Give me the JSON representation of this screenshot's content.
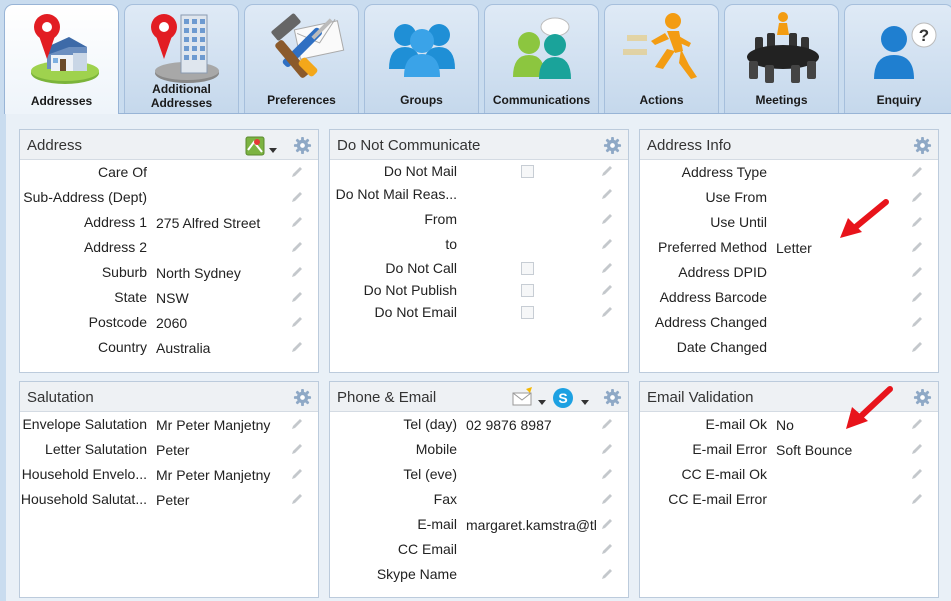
{
  "tabs": [
    {
      "label": "Addresses",
      "icon": "house-pin-icon"
    },
    {
      "label": "Additional Addresses",
      "icon": "building-pin-icon"
    },
    {
      "label": "Preferences",
      "icon": "tools-envelope-icon"
    },
    {
      "label": "Groups",
      "icon": "people-group-icon"
    },
    {
      "label": "Communications",
      "icon": "people-chat-icon"
    },
    {
      "label": "Actions",
      "icon": "running-man-icon"
    },
    {
      "label": "Meetings",
      "icon": "meeting-table-icon"
    },
    {
      "label": "Enquiry",
      "icon": "person-question-icon"
    }
  ],
  "address": {
    "title": "Address",
    "rows": [
      {
        "label": "Care Of",
        "value": ""
      },
      {
        "label": "Sub-Address (Dept)",
        "value": ""
      },
      {
        "label": "Address 1",
        "value": "275 Alfred Street"
      },
      {
        "label": "Address 2",
        "value": ""
      },
      {
        "label": "Suburb",
        "value": "North Sydney"
      },
      {
        "label": "State",
        "value": "NSW"
      },
      {
        "label": "Postcode",
        "value": "2060"
      },
      {
        "label": "Country",
        "value": "Australia"
      }
    ]
  },
  "dnc": {
    "title": "Do Not Communicate",
    "rows": [
      {
        "label": "Do Not Mail",
        "type": "checkbox"
      },
      {
        "label": "Do Not Mail Reas...",
        "type": "text",
        "value": ""
      },
      {
        "label": "From",
        "type": "text",
        "value": ""
      },
      {
        "label": "to",
        "type": "text",
        "value": ""
      },
      {
        "label": "Do Not Call",
        "type": "checkbox"
      },
      {
        "label": "Do Not Publish",
        "type": "checkbox"
      },
      {
        "label": "Do Not Email",
        "type": "checkbox"
      }
    ]
  },
  "address_info": {
    "title": "Address Info",
    "rows": [
      {
        "label": "Address Type",
        "value": ""
      },
      {
        "label": "Use From",
        "value": ""
      },
      {
        "label": "Use Until",
        "value": ""
      },
      {
        "label": "Preferred Method",
        "value": "Letter"
      },
      {
        "label": "Address DPID",
        "value": ""
      },
      {
        "label": "Address Barcode",
        "value": ""
      },
      {
        "label": "Address Changed",
        "value": ""
      },
      {
        "label": "Date Changed",
        "value": ""
      }
    ]
  },
  "salutation": {
    "title": "Salutation",
    "rows": [
      {
        "label": "Envelope Salutation",
        "value": "Mr Peter Manjetny"
      },
      {
        "label": "Letter Salutation",
        "value": "Peter"
      },
      {
        "label": "Household Envelo...",
        "value": "Mr Peter Manjetny"
      },
      {
        "label": "Household Salutat...",
        "value": "Peter"
      }
    ]
  },
  "phone_email": {
    "title": "Phone & Email",
    "rows": [
      {
        "label": "Tel (day)",
        "value": "02 9876 8987"
      },
      {
        "label": "Mobile",
        "value": ""
      },
      {
        "label": "Tel (eve)",
        "value": ""
      },
      {
        "label": "Fax",
        "value": ""
      },
      {
        "label": "E-mail",
        "value": "margaret.kamstra@th"
      },
      {
        "label": "CC Email",
        "value": ""
      },
      {
        "label": "Skype Name",
        "value": ""
      }
    ]
  },
  "email_validation": {
    "title": "Email Validation",
    "rows": [
      {
        "label": "E-mail Ok",
        "value": "No"
      },
      {
        "label": "E-mail Error",
        "value": "Soft Bounce"
      },
      {
        "label": "CC E-mail Ok",
        "value": ""
      },
      {
        "label": "CC E-mail Error",
        "value": ""
      }
    ]
  },
  "colors": {
    "background": "#c9dcef",
    "arrow": "#e8141b",
    "gear": "#8fa9c6"
  }
}
